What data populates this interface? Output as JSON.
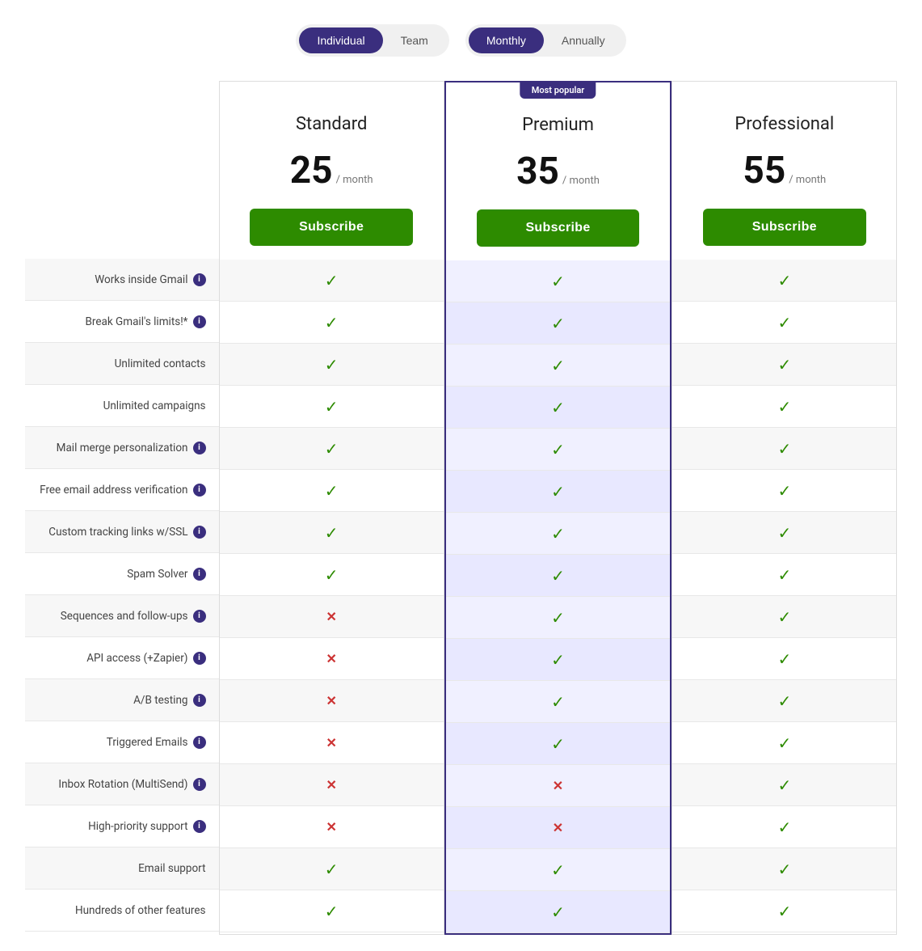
{
  "toggles": {
    "audience": {
      "options": [
        "Individual",
        "Team"
      ],
      "active": "Individual"
    },
    "billing": {
      "options": [
        "Monthly",
        "Annually"
      ],
      "active": "Monthly"
    }
  },
  "plans": [
    {
      "id": "standard",
      "name": "Standard",
      "price": "25",
      "period": "/ month",
      "featured": false,
      "subscribe_label": "Subscribe"
    },
    {
      "id": "premium",
      "name": "Premium",
      "price": "35",
      "period": "/ month",
      "featured": true,
      "badge": "Most popular",
      "subscribe_label": "Subscribe"
    },
    {
      "id": "professional",
      "name": "Professional",
      "price": "55",
      "period": "/ month",
      "featured": false,
      "subscribe_label": "Subscribe"
    }
  ],
  "features": [
    {
      "label": "Works inside Gmail",
      "has_info": true,
      "standard": "check",
      "premium": "check",
      "professional": "check"
    },
    {
      "label": "Break Gmail's limits!*",
      "has_info": true,
      "standard": "check",
      "premium": "check",
      "professional": "check"
    },
    {
      "label": "Unlimited contacts",
      "has_info": false,
      "standard": "check",
      "premium": "check",
      "professional": "check"
    },
    {
      "label": "Unlimited campaigns",
      "has_info": false,
      "standard": "check",
      "premium": "check",
      "professional": "check"
    },
    {
      "label": "Mail merge personalization",
      "has_info": true,
      "standard": "check",
      "premium": "check",
      "professional": "check"
    },
    {
      "label": "Free email address verification",
      "has_info": true,
      "standard": "check",
      "premium": "check",
      "professional": "check"
    },
    {
      "label": "Custom tracking links w/SSL",
      "has_info": true,
      "standard": "check",
      "premium": "check",
      "professional": "check"
    },
    {
      "label": "Spam Solver",
      "has_info": true,
      "standard": "check",
      "premium": "check",
      "professional": "check"
    },
    {
      "label": "Sequences and follow-ups",
      "has_info": true,
      "standard": "cross",
      "premium": "check",
      "professional": "check"
    },
    {
      "label": "API access (+Zapier)",
      "has_info": true,
      "standard": "cross",
      "premium": "check",
      "professional": "check"
    },
    {
      "label": "A/B testing",
      "has_info": true,
      "standard": "cross",
      "premium": "check",
      "professional": "check"
    },
    {
      "label": "Triggered Emails",
      "has_info": true,
      "standard": "cross",
      "premium": "check",
      "professional": "check"
    },
    {
      "label": "Inbox Rotation (MultiSend)",
      "has_info": true,
      "standard": "cross",
      "premium": "cross",
      "professional": "check"
    },
    {
      "label": "High-priority support",
      "has_info": true,
      "standard": "cross",
      "premium": "cross",
      "professional": "check"
    },
    {
      "label": "Email support",
      "has_info": false,
      "standard": "check",
      "premium": "check",
      "professional": "check"
    },
    {
      "label": "Hundreds of other features",
      "has_info": false,
      "standard": "check",
      "premium": "check",
      "professional": "check"
    }
  ]
}
